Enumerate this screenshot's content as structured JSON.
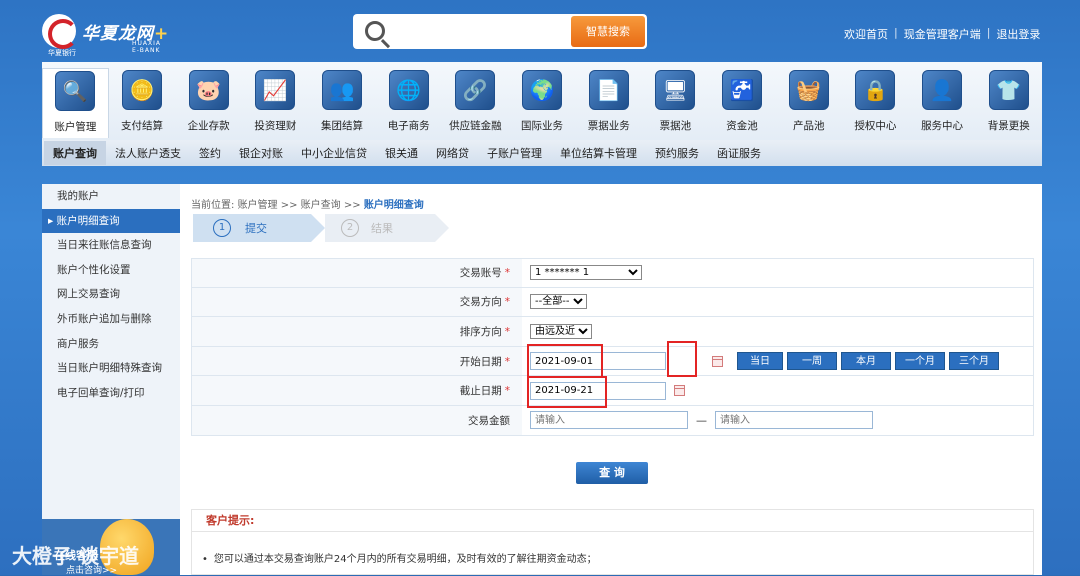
{
  "header": {
    "logo_text": "华夏龙网",
    "logo_plus": "+",
    "logo_sub": "HUAXIA E-BANK",
    "logo_mark_text": "华夏银行",
    "search_placeholder": "",
    "search_button": "智慧搜索",
    "links": [
      "欢迎首页",
      "现金管理客户端",
      "退出登录"
    ]
  },
  "nav": {
    "items": [
      {
        "label": "账户管理",
        "icon": "🔍",
        "icon_name": "account-icon",
        "active": true
      },
      {
        "label": "支付结算",
        "icon": "🪙",
        "icon_name": "coins-icon"
      },
      {
        "label": "企业存款",
        "icon": "🐷",
        "icon_name": "piggybank-icon"
      },
      {
        "label": "投资理财",
        "icon": "📈",
        "icon_name": "investment-icon"
      },
      {
        "label": "集团结算",
        "icon": "👥",
        "icon_name": "group-icon"
      },
      {
        "label": "电子商务",
        "icon": "🌐",
        "icon_name": "ecommerce-icon"
      },
      {
        "label": "供应链金融",
        "icon": "🔗",
        "icon_name": "supply-chain-icon"
      },
      {
        "label": "国际业务",
        "icon": "🌍",
        "icon_name": "globe-icon"
      },
      {
        "label": "票据业务",
        "icon": "📄",
        "icon_name": "bill-icon"
      },
      {
        "label": "票据池",
        "icon": "🖥",
        "icon_name": "bill-pool-icon"
      },
      {
        "label": "资金池",
        "icon": "🚰",
        "icon_name": "fund-pool-icon"
      },
      {
        "label": "产品池",
        "icon": "🧺",
        "icon_name": "product-pool-icon"
      },
      {
        "label": "授权中心",
        "icon": "🔒",
        "icon_name": "lock-icon"
      },
      {
        "label": "服务中心",
        "icon": "👤",
        "icon_name": "service-icon"
      },
      {
        "label": "背景更换",
        "icon": "👕",
        "icon_name": "shirt-icon"
      }
    ],
    "sub_items": [
      "账户查询",
      "法人账户透支",
      "签约",
      "银企对账",
      "中小企业信贷",
      "银关通",
      "网络贷",
      "子账户管理",
      "单位结算卡管理",
      "预约服务",
      "函证服务"
    ]
  },
  "sidebar": {
    "items": [
      "我的账户",
      "账户明细查询",
      "当日来往账信息查询",
      "账户个性化设置",
      "网上交易查询",
      "外币账户追加与删除",
      "商户服务",
      "当日账户明细特殊查询",
      "电子回单查询/打印"
    ],
    "active_index": 1,
    "promo_text": "在线客服",
    "promo_link": "点击咨询>>"
  },
  "main": {
    "breadcrumb": {
      "prefix": "当前位置:",
      "path": "账户管理 >> 账户查询 >>",
      "current": "账户明细查询"
    },
    "steps": [
      {
        "num": "1",
        "label": "提交"
      },
      {
        "num": "2",
        "label": "结果"
      }
    ],
    "form": {
      "account_label": "交易账号",
      "account_value": "1 *******      1",
      "direction_label": "交易方向",
      "direction_value": "--全部--",
      "sort_label": "排序方向",
      "sort_value": "由远及近",
      "start_label": "开始日期",
      "start_value": "2021-09-01",
      "end_label": "截止日期",
      "end_value": "2021-09-21",
      "amount_label": "交易金额",
      "amount_placeholder": "请输入",
      "amount_dash": "—",
      "quick_buttons": [
        "当日",
        "一周",
        "本月",
        "一个月",
        "三个月"
      ]
    },
    "query_button": "查 询",
    "tips_title": "客户提示:",
    "tips": [
      "您可以通过本交易查询账户24个月内的所有交易明细，及时有效的了解往期资金动态；"
    ]
  },
  "watermark": "大橙子 谈宇道"
}
